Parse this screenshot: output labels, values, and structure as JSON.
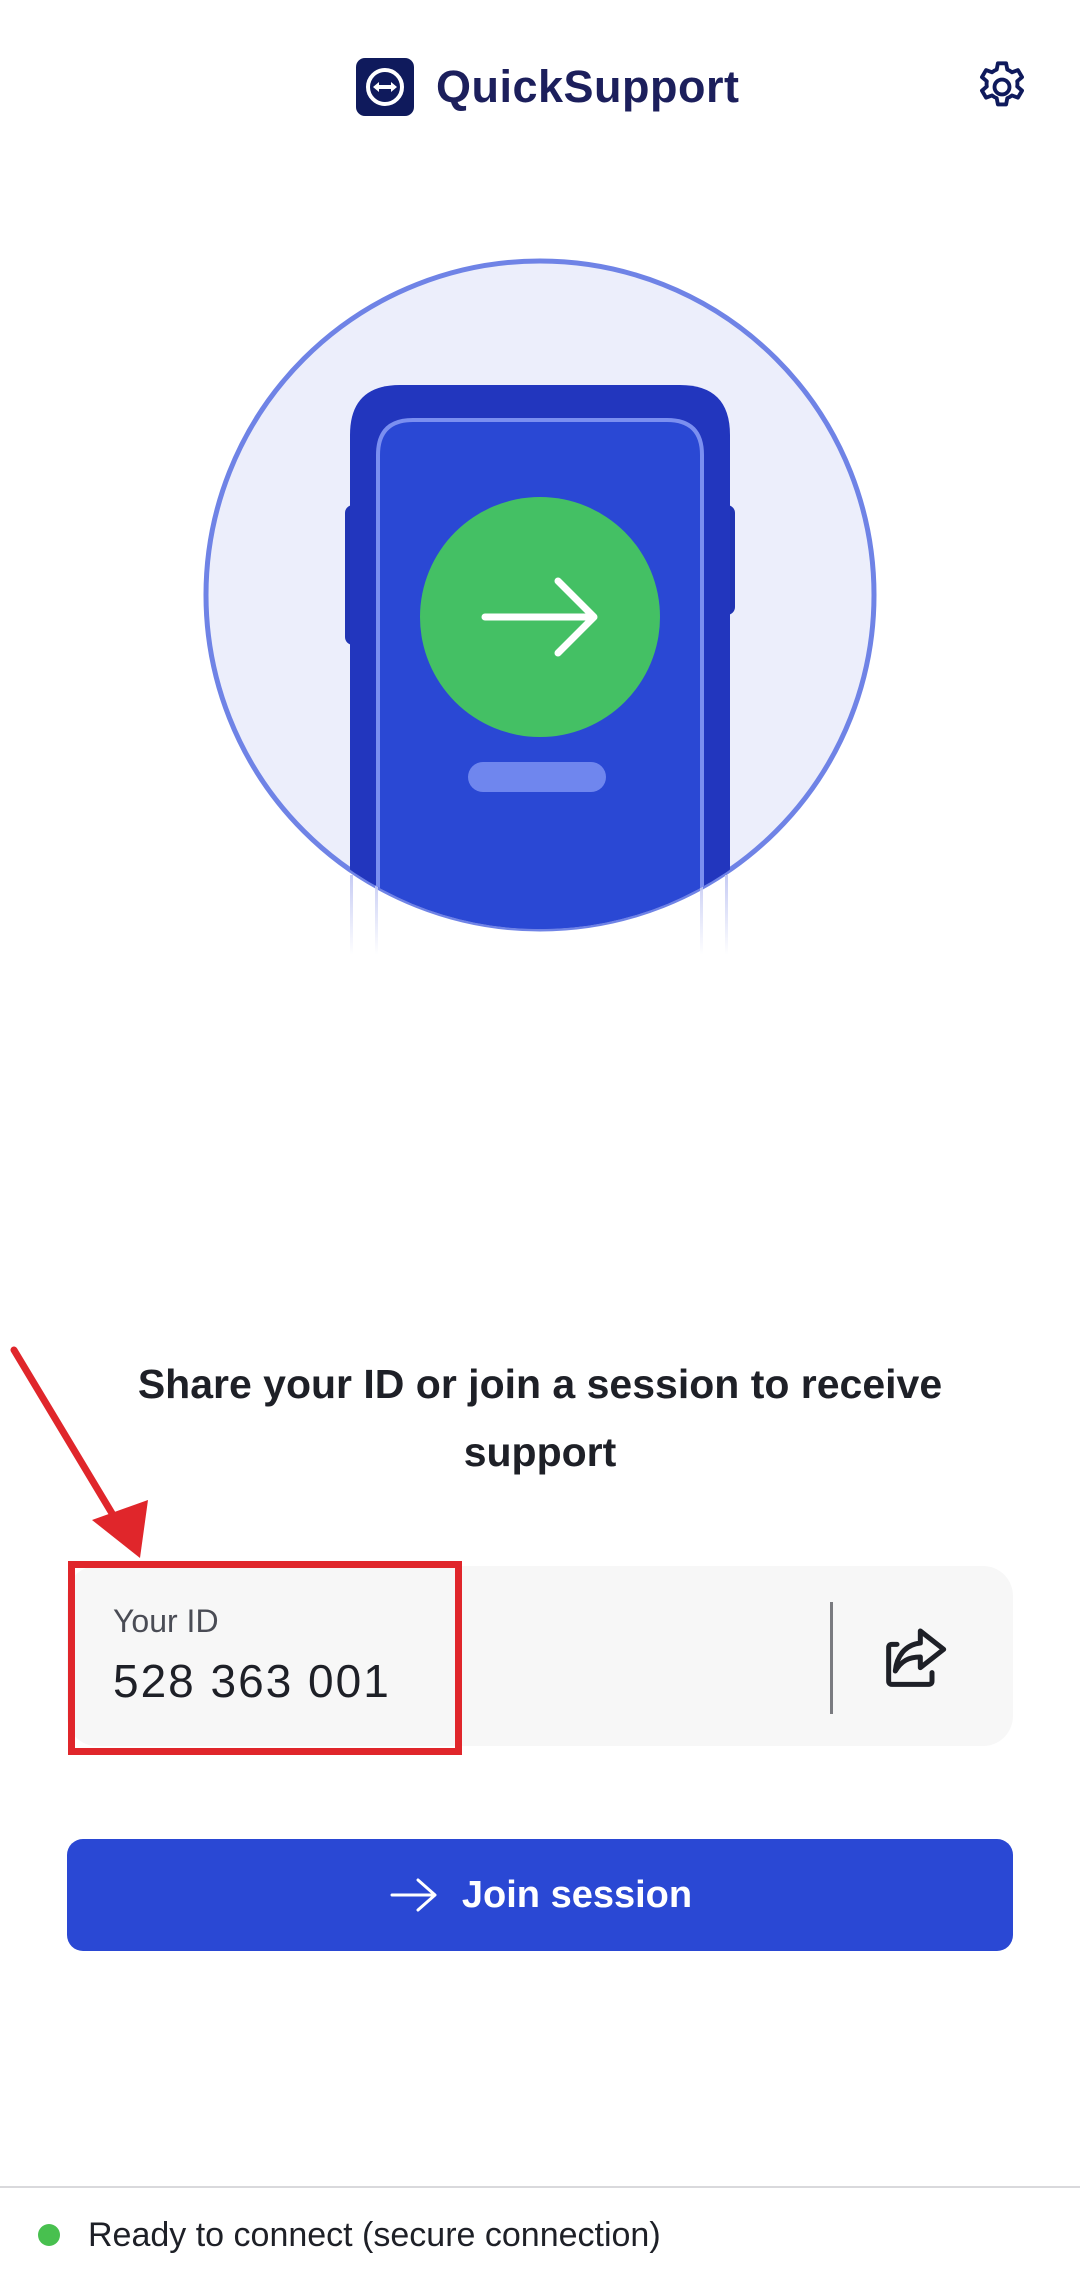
{
  "app": {
    "title": "QuickSupport"
  },
  "header": {
    "settings_icon": "gear-icon"
  },
  "main": {
    "headline": "Share your ID or join a session to receive support"
  },
  "id_card": {
    "label": "Your ID",
    "value": "528 363 001",
    "share_icon": "share-icon"
  },
  "join": {
    "label": "Join session",
    "icon": "arrow-right-icon"
  },
  "status": {
    "text": "Ready to connect (secure connection)",
    "indicator_color": "#48c04f"
  },
  "colors": {
    "brand_primary": "#2a48d4",
    "brand_dark": "#1c1f5c",
    "success_green": "#44c064",
    "annotation_red": "#e0262b"
  }
}
